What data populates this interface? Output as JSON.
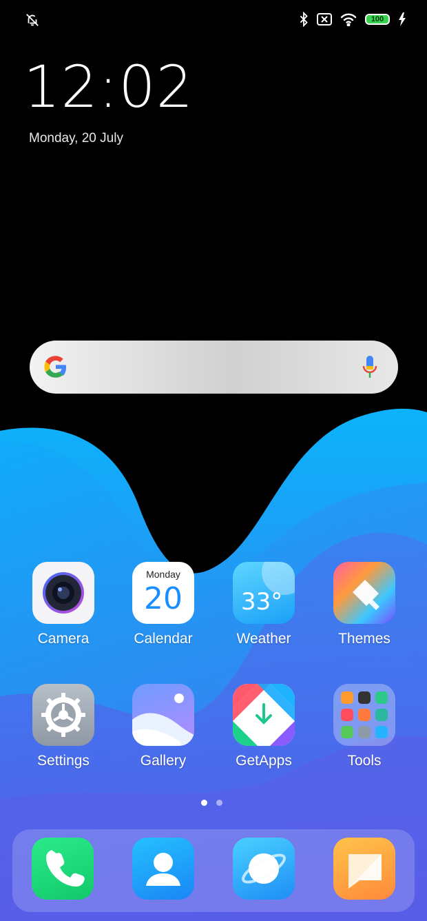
{
  "status": {
    "battery": "100",
    "icons": [
      "alarm-off-icon",
      "bluetooth-icon",
      "sim-off-icon",
      "wifi-icon",
      "charging-icon"
    ]
  },
  "lockscreen": {
    "time": "12:02",
    "date": "Monday, 20 July"
  },
  "search": {
    "provider_icon": "google-logo",
    "voice_icon": "microphone-icon"
  },
  "apps": [
    {
      "label": "Camera"
    },
    {
      "label": "Calendar",
      "day": "Monday",
      "date_number": "20"
    },
    {
      "label": "Weather",
      "temperature": "33°"
    },
    {
      "label": "Themes"
    },
    {
      "label": "Settings"
    },
    {
      "label": "Gallery"
    },
    {
      "label": "GetApps"
    },
    {
      "label": "Tools"
    }
  ],
  "pager": {
    "pages": 2,
    "current": 1
  },
  "dock": [
    "phone-icon",
    "contacts-icon",
    "browser-icon",
    "messages-icon"
  ],
  "colors": {
    "wave_light": "#0aa9f5",
    "wave_deep": "#4b63ea",
    "wave_purple": "#6a4fe6",
    "battery_green": "#37d34f"
  }
}
